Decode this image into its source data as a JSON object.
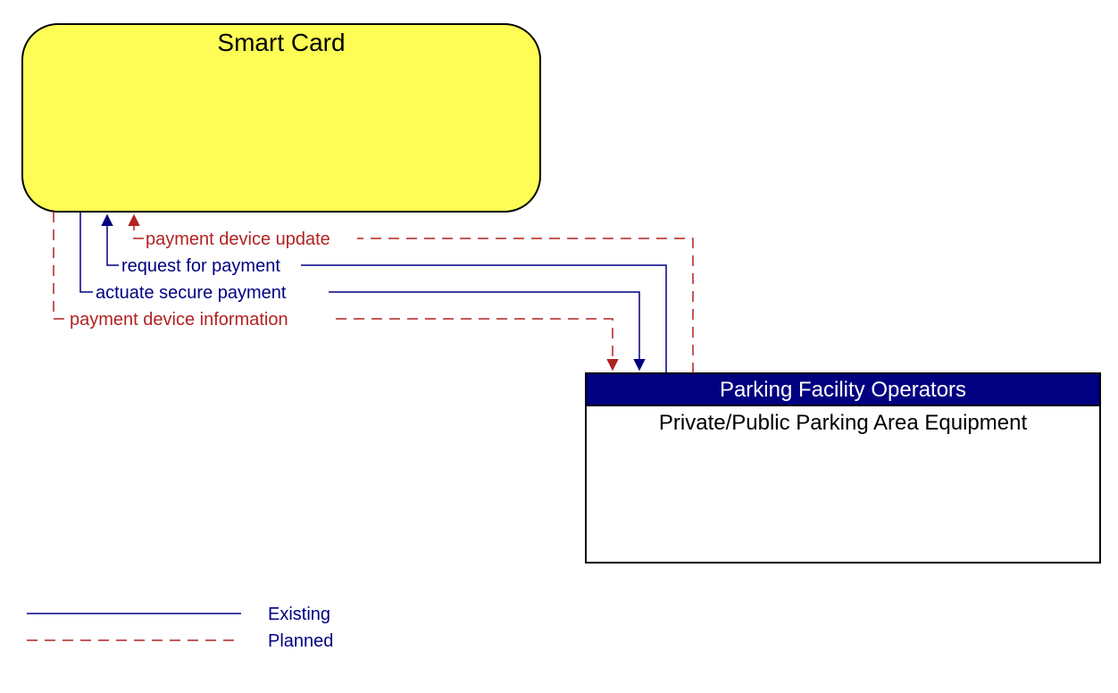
{
  "colors": {
    "existing": "#000080",
    "planned": "#b22222",
    "smartCardFill": "#fdfd55",
    "parkingHeaderFill": "#000080"
  },
  "nodes": {
    "smartCard": {
      "title": "Smart Card"
    },
    "parking": {
      "header": "Parking Facility Operators",
      "subtitle": "Private/Public Parking Area Equipment"
    }
  },
  "flows": {
    "paymentDeviceUpdate": {
      "label": "payment device update",
      "type": "planned",
      "direction": "to_smartcard"
    },
    "requestForPayment": {
      "label": "request for payment",
      "type": "existing",
      "direction": "to_smartcard"
    },
    "actuateSecurePayment": {
      "label": "actuate secure payment",
      "type": "existing",
      "direction": "to_parking"
    },
    "paymentDeviceInformation": {
      "label": "payment device information",
      "type": "planned",
      "direction": "to_parking"
    }
  },
  "legend": {
    "existing": "Existing",
    "planned": "Planned"
  }
}
